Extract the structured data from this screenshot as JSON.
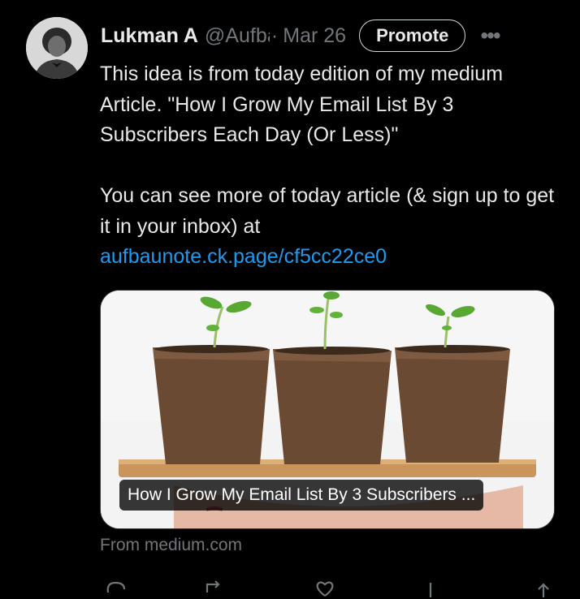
{
  "tweet": {
    "author_name": "Lukman A",
    "handle": "@Aufbaunote",
    "separator": "·",
    "date": "Mar 26",
    "promote_label": "Promote",
    "more_label": "•••",
    "body_line1": "This idea is from today edition of my medium Article. \"How I Grow My Email List By 3 Subscribers Each Day (Or Less)\"",
    "body_line2": "You can see more of today article (& sign up to get it in your inbox) at",
    "link_text": "aufbaunote.ck.page/cf5cc22ce0"
  },
  "card": {
    "title": "How I Grow My Email List By 3 Subscribers ...",
    "source": "From medium.com"
  },
  "actions": [
    "reply-icon",
    "retweet-icon",
    "like-icon",
    "views-icon",
    "share-icon"
  ],
  "colors": {
    "background": "#000000",
    "text": "#e7e9ea",
    "secondary": "#71767b",
    "link": "#1d9bf0"
  }
}
